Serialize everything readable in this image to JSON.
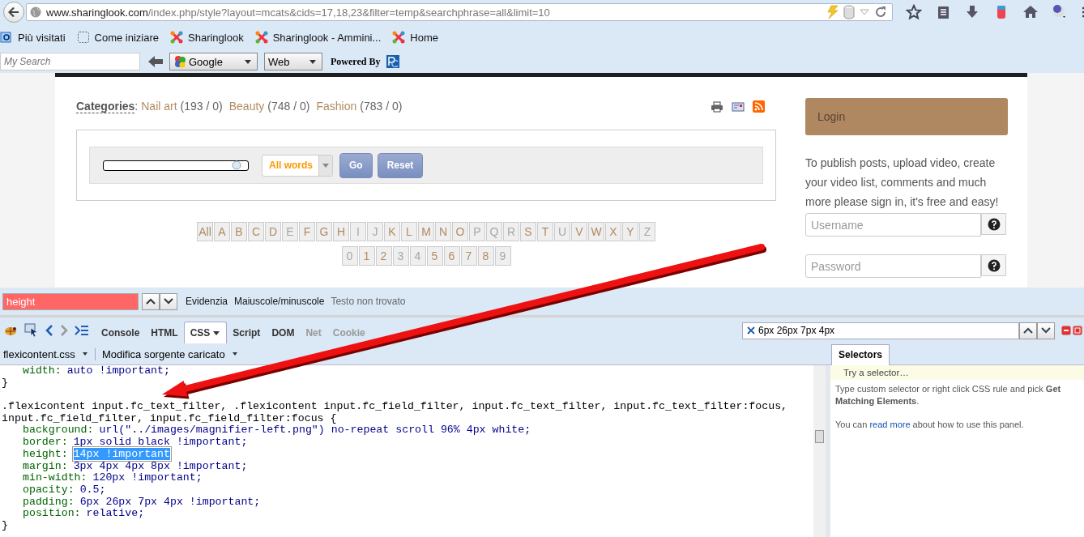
{
  "browser": {
    "url_host": "www.sharinglook.com",
    "url_path": "/index.php/style?layout=mcats&cids=17,18,23&filter=temp&searchphrase=all&limit=10"
  },
  "bookmarks": [
    {
      "kind": "search",
      "label": "Più visitati"
    },
    {
      "kind": "blank",
      "label": "Come iniziare"
    },
    {
      "kind": "site",
      "label": "Sharinglook"
    },
    {
      "kind": "site",
      "label": "Sharinglook - Ammini..."
    },
    {
      "kind": "site",
      "label": "Home"
    }
  ],
  "search_toolbar": {
    "placeholder": "My Search",
    "engine": "Google",
    "scope": "Web",
    "powered_by": "Powered By"
  },
  "page": {
    "categories_label": "Categories",
    "separator": ":",
    "categories": [
      {
        "name": "Nail art",
        "count": "(193 / 0)"
      },
      {
        "name": "Beauty",
        "count": "(748 / 0)"
      },
      {
        "name": "Fashion",
        "count": "(783 / 0)"
      }
    ],
    "search": {
      "mode": "All words",
      "go": "Go",
      "reset": "Reset"
    },
    "letters": [
      {
        "label": "All",
        "disabled": false
      },
      {
        "label": "A",
        "disabled": false
      },
      {
        "label": "B",
        "disabled": false
      },
      {
        "label": "C",
        "disabled": false
      },
      {
        "label": "D",
        "disabled": false
      },
      {
        "label": "E",
        "disabled": true
      },
      {
        "label": "F",
        "disabled": false
      },
      {
        "label": "G",
        "disabled": false
      },
      {
        "label": "H",
        "disabled": false
      },
      {
        "label": "I",
        "disabled": true
      },
      {
        "label": "J",
        "disabled": true
      },
      {
        "label": "K",
        "disabled": false
      },
      {
        "label": "L",
        "disabled": false
      },
      {
        "label": "M",
        "disabled": false
      },
      {
        "label": "N",
        "disabled": false
      },
      {
        "label": "O",
        "disabled": false
      },
      {
        "label": "P",
        "disabled": true
      },
      {
        "label": "Q",
        "disabled": true
      },
      {
        "label": "R",
        "disabled": true
      },
      {
        "label": "S",
        "disabled": false
      },
      {
        "label": "T",
        "disabled": false
      },
      {
        "label": "U",
        "disabled": true
      },
      {
        "label": "V",
        "disabled": false
      },
      {
        "label": "W",
        "disabled": false
      },
      {
        "label": "X",
        "disabled": false
      },
      {
        "label": "Y",
        "disabled": false
      },
      {
        "label": "Z",
        "disabled": true
      }
    ],
    "digits": [
      {
        "label": "0",
        "disabled": true
      },
      {
        "label": "1",
        "disabled": false
      },
      {
        "label": "2",
        "disabled": false
      },
      {
        "label": "3",
        "disabled": true
      },
      {
        "label": "4",
        "disabled": true
      },
      {
        "label": "5",
        "disabled": false
      },
      {
        "label": "6",
        "disabled": false
      },
      {
        "label": "7",
        "disabled": false
      },
      {
        "label": "8",
        "disabled": false
      },
      {
        "label": "9",
        "disabled": true
      }
    ],
    "login": {
      "title": "Login",
      "text": "To publish posts, upload video, create your video list, comments and much more please sign in, it's free and easy!",
      "username_placeholder": "Username",
      "password_placeholder": "Password"
    }
  },
  "find_bar": {
    "value": "height",
    "not_found": true,
    "highlight": "Evidenzia",
    "match_case": "Maiuscole/minuscole",
    "status": "Testo non trovato"
  },
  "firebug": {
    "tabs": [
      {
        "label": "Console",
        "selected": false,
        "disabled": false
      },
      {
        "label": "HTML",
        "selected": false,
        "disabled": false
      },
      {
        "label": "CSS",
        "selected": true,
        "disabled": false
      },
      {
        "label": "Script",
        "selected": false,
        "disabled": false
      },
      {
        "label": "DOM",
        "selected": false,
        "disabled": false
      },
      {
        "label": "Net",
        "selected": false,
        "disabled": true
      },
      {
        "label": "Cookie",
        "selected": false,
        "disabled": true
      }
    ],
    "search_value": "6px 26px 7px 4px",
    "file": "flexicontent.css",
    "edit_mode": "Modifica sorgente caricato",
    "code_lines": [
      {
        "kind": "declaration",
        "property": "width:",
        "value": "auto !important;",
        "selected": false
      },
      {
        "kind": "brace",
        "text": "}"
      },
      {
        "kind": "blank"
      },
      {
        "kind": "selector",
        "text": ".flexicontent input.fc_text_filter, .flexicontent input.fc_field_filter, input.fc_text_filter, input.fc_text_filter:focus,"
      },
      {
        "kind": "selector",
        "text": "input.fc_field_filter, input.fc_field_filter:focus {"
      },
      {
        "kind": "declaration",
        "property": "background:",
        "value": "url(\"../images/magnifier-left.png\") no-repeat scroll 96% 4px white;",
        "selected": false
      },
      {
        "kind": "declaration",
        "property": "border:",
        "value": "1px solid black !important;",
        "selected": false
      },
      {
        "kind": "declaration",
        "property": "height:",
        "value": "14px !important",
        "selected": true
      },
      {
        "kind": "declaration",
        "property": "margin:",
        "value": "3px 4px 4px 8px !important;",
        "selected": false
      },
      {
        "kind": "declaration",
        "property": "min-width:",
        "value": "120px !important;",
        "selected": false
      },
      {
        "kind": "declaration",
        "property": "opacity:",
        "value": "0.5;",
        "selected": false
      },
      {
        "kind": "declaration",
        "property": "padding:",
        "value": "6px 26px 7px 4px !important;",
        "selected": false
      },
      {
        "kind": "declaration",
        "property": "position:",
        "value": "relative;",
        "selected": false
      },
      {
        "kind": "brace",
        "text": "}"
      }
    ],
    "side_tabs": [
      {
        "label": "Selectors",
        "selected": true
      }
    ],
    "selector_placeholder": "Try a selector…",
    "help_text": "Type custom selector or right click CSS rule and pick **Get Matching Elements**.",
    "help_link": {
      "before": "You can",
      "link": "read more",
      "after": "about how to use this panel."
    }
  }
}
